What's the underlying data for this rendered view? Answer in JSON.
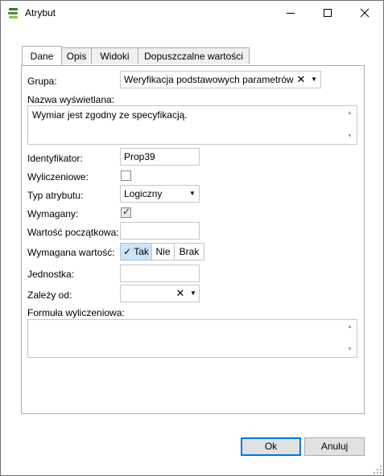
{
  "window": {
    "title": "Atrybut",
    "app_icon": "layers-icon",
    "minimize_icon": "minimize-icon",
    "maximize_icon": "maximize-icon",
    "close_icon": "close-icon"
  },
  "tabs": [
    {
      "label": "Dane",
      "active": true
    },
    {
      "label": "Opis",
      "active": false
    },
    {
      "label": "Widoki",
      "active": false
    },
    {
      "label": "Dopuszczalne wartości",
      "active": false
    }
  ],
  "form": {
    "grupa": {
      "label": "Grupa:",
      "value": "Weryfikacja podstawowych parametrów",
      "clear_glyph": "✕",
      "arrow_glyph": "▼"
    },
    "nazwa": {
      "label": "Nazwa wyświetlana:",
      "value": "Wymiar jest zgodny ze specyfikacją."
    },
    "identyfikator": {
      "label": "Identyfikator:",
      "value": "Prop39"
    },
    "wyliczeniowe": {
      "label": "Wyliczeniowe:",
      "checked": false
    },
    "typ": {
      "label": "Typ atrybutu:",
      "value": "Logiczny",
      "arrow_glyph": "▼"
    },
    "wymagany": {
      "label": "Wymagany:",
      "checked": true,
      "check_glyph": "✓"
    },
    "wartosc_poczatkowa": {
      "label": "Wartość początkowa:",
      "value": ""
    },
    "wymagana_wartosc": {
      "label": "Wymagana wartość:",
      "options": [
        {
          "label": "✓ Tak",
          "selected": true
        },
        {
          "label": "Nie",
          "selected": false
        },
        {
          "label": "Brak",
          "selected": false
        }
      ]
    },
    "jednostka": {
      "label": "Jednostka:",
      "value": ""
    },
    "zalezy_od": {
      "label": "Zależy od:",
      "value": "",
      "clear_glyph": "✕",
      "arrow_glyph": "▼"
    },
    "formula": {
      "label": "Formuła wyliczeniowa:",
      "value": ""
    },
    "scroll_up_glyph": "▲",
    "scroll_down_glyph": "▼"
  },
  "buttons": {
    "ok": "Ok",
    "cancel": "Anuluj"
  },
  "colors": {
    "accent": "#0078d7",
    "selected_segment": "#cce4f7",
    "icon_green_dark": "#2e7d32",
    "icon_green_light": "#8bc34a"
  }
}
